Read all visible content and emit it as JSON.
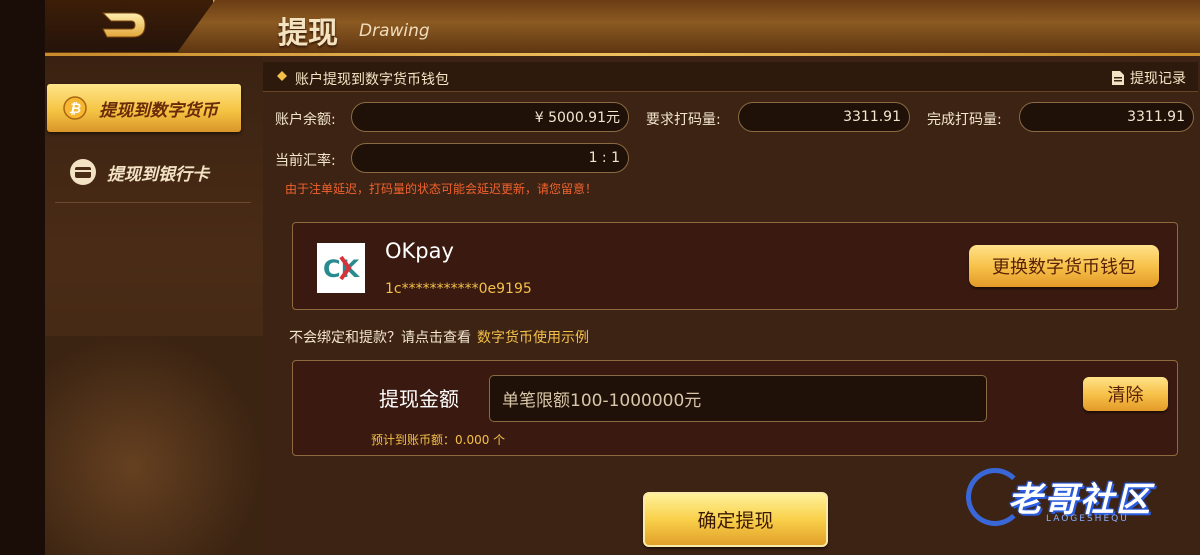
{
  "header": {
    "title_zh": "提现",
    "title_en": "Drawing"
  },
  "sidebar": {
    "items": [
      {
        "label": "提现到数字货币",
        "icon": "bitcoin-icon",
        "active": true
      },
      {
        "label": "提现到银行卡",
        "icon": "bank-card-icon",
        "active": false
      }
    ]
  },
  "section": {
    "title": "账户提现到数字货币钱包",
    "record_label": "提现记录"
  },
  "account": {
    "balance_label": "账户余额:",
    "balance_value": "¥ 5000.91元",
    "required_label": "要求打码量:",
    "required_value": "3311.91",
    "completed_label": "完成打码量:",
    "completed_value": "3311.91",
    "rate_label": "当前汇率:",
    "rate_value": "1 : 1",
    "notice": "由于注单延迟，打码量的状态可能会延迟更新，请您留意！"
  },
  "wallet": {
    "name": "OKpay",
    "address": "1c***********0e9195",
    "logo_text": "CK",
    "change_button": "更换数字货币钱包"
  },
  "help": {
    "text": "不会绑定和提款？请点击查看",
    "link": "数字货币使用示例"
  },
  "amount": {
    "label": "提现金额",
    "placeholder": "单笔限额100-1000000元",
    "clear_button": "清除",
    "expected": "预计到账币额：0.000 个"
  },
  "confirm_button": "确定提现",
  "watermark": {
    "text": "老哥社区",
    "sub": "LAOGESHEQU"
  },
  "colors": {
    "accent_gold": "#f5c443",
    "notice_red": "#f0622f",
    "link_gold": "#f3c04a"
  }
}
